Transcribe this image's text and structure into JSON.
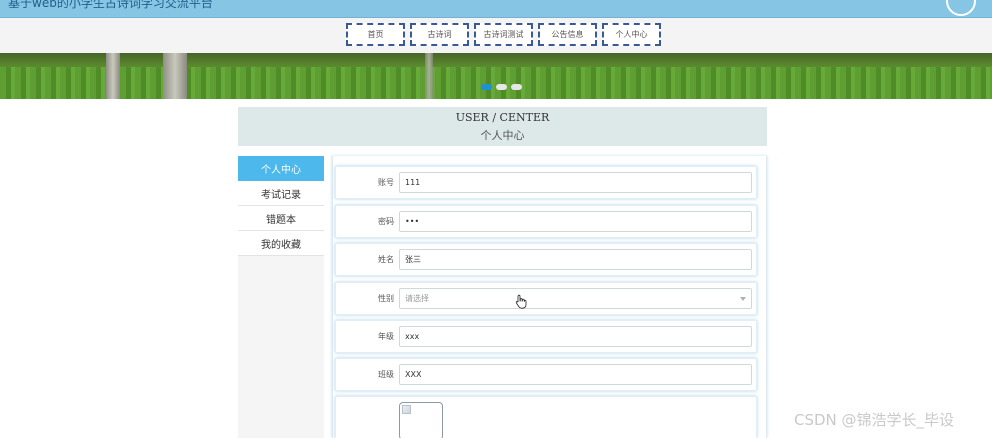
{
  "header": {
    "site_title": "基于web的小学生古诗词学习交流平台"
  },
  "nav": {
    "items": [
      {
        "label": "首页"
      },
      {
        "label": "古诗词"
      },
      {
        "label": "古诗词测试"
      },
      {
        "label": "公告信息"
      },
      {
        "label": "个人中心"
      }
    ]
  },
  "banner": {
    "slide_count": 3,
    "active_slide": 1
  },
  "page_title": {
    "en": "USER / CENTER",
    "cn": "个人中心"
  },
  "sidebar": {
    "items": [
      {
        "label": "个人中心",
        "active": true
      },
      {
        "label": "考试记录",
        "active": false
      },
      {
        "label": "错题本",
        "active": false
      },
      {
        "label": "我的收藏",
        "active": false
      }
    ]
  },
  "form": {
    "account_label": "账号",
    "account_value": "111",
    "password_label": "密码",
    "password_value": "•••",
    "name_label": "姓名",
    "name_value": "张三",
    "gender_label": "性别",
    "gender_placeholder": "请选择",
    "grade_label": "年级",
    "grade_value": "xxx",
    "class_label": "班级",
    "class_value": "XXX"
  },
  "colors": {
    "accent": "#4cb8ec",
    "topbar": "#86c5e3",
    "nav_border": "#3b5a94",
    "title_bg": "#dde9e8"
  },
  "watermark": "CSDN @锦浩学长_毕设"
}
